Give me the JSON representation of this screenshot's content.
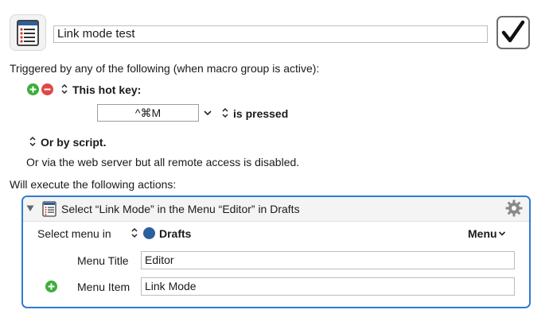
{
  "macro": {
    "name": "Link mode test",
    "enabled": true
  },
  "triggers": {
    "heading": "Triggered by any of the following (when macro group is active):",
    "hotkey_label": "This hot key:",
    "hotkey_value": "^⌘M",
    "hotkey_condition": "is pressed",
    "script_label": "Or by script.",
    "web_server_note": "Or via the web server but all remote access is disabled."
  },
  "actions": {
    "heading": "Will execute the following actions:",
    "items": [
      {
        "title": "Select “Link Mode” in the Menu “Editor” in Drafts",
        "select_menu_label": "Select menu in",
        "app_name": "Drafts",
        "menu_dropdown": "Menu",
        "menu_title_label": "Menu Title",
        "menu_title_value": "Editor",
        "menu_item_label": "Menu Item",
        "menu_item_value": "Link Mode"
      }
    ]
  },
  "icons": {
    "macro": "macro-list-icon",
    "enabled": "checkmark-icon",
    "add": "add-circle-icon",
    "remove": "remove-circle-icon",
    "updown": "updown-chevron-icon",
    "collapse": "disclosure-triangle-icon",
    "action": "action-list-icon",
    "gear": "gear-icon",
    "app": "drafts-app-icon"
  },
  "colors": {
    "accent": "#2e7bd6",
    "add": "#3cae3c",
    "remove": "#e04848",
    "icon_red": "#d83a2f",
    "icon_blue": "#2b5f9f"
  }
}
